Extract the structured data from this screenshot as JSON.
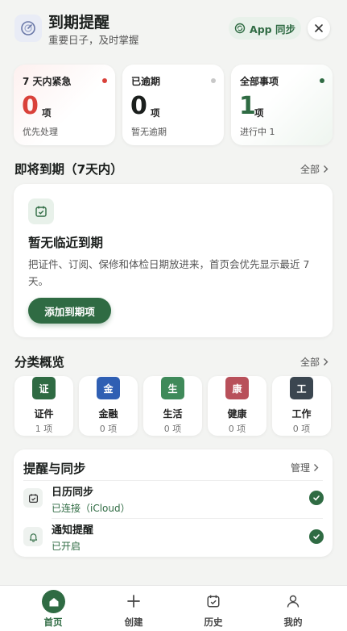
{
  "header": {
    "title": "到期提醒",
    "subtitle": "重要日子，及时掌握",
    "sync_button": "App 同步"
  },
  "stats": [
    {
      "label": "7 天内紧急",
      "value": "0",
      "unit": "项",
      "desc": "优先处理",
      "dot_color": "#d9413a",
      "value_color": "#d9413a"
    },
    {
      "label": "已逾期",
      "value": "0",
      "unit": "项",
      "desc": "暂无逾期",
      "dot_color": "#c8c8c8",
      "value_color": "#1b1f1d"
    },
    {
      "label": "全部事项",
      "value": "1",
      "unit": "项",
      "desc": "进行中 1",
      "dot_color": "#2f6b43",
      "value_color": "#2f6b43"
    }
  ],
  "upcoming": {
    "title": "即将到期（7天内）",
    "link": "全部",
    "empty_title": "暂无临近到期",
    "empty_desc": "把证件、订阅、保修和体检日期放进来，首页会优先显示最近 7 天。",
    "add_button": "添加到期项"
  },
  "categories": {
    "title": "分类概览",
    "link": "全部",
    "items": [
      {
        "badge": "证",
        "name": "证件",
        "count": "1 项",
        "color": "#2f6b43"
      },
      {
        "badge": "金",
        "name": "金融",
        "count": "0 项",
        "color": "#2f5fb3"
      },
      {
        "badge": "生",
        "name": "生活",
        "count": "0 项",
        "color": "#3f8a5a"
      },
      {
        "badge": "康",
        "name": "健康",
        "count": "0 项",
        "color": "#b8505a"
      },
      {
        "badge": "工",
        "name": "工作",
        "count": "0 项",
        "color": "#3b4650"
      }
    ]
  },
  "reminders": {
    "title": "提醒与同步",
    "link": "管理",
    "rows": [
      {
        "title": "日历同步",
        "status": "已连接（iCloud）"
      },
      {
        "title": "通知提醒",
        "status": "已开启"
      }
    ]
  },
  "nav": {
    "items": [
      {
        "label": "首页"
      },
      {
        "label": "创建"
      },
      {
        "label": "历史"
      },
      {
        "label": "我的"
      }
    ],
    "active_color": "#2f6b43"
  }
}
